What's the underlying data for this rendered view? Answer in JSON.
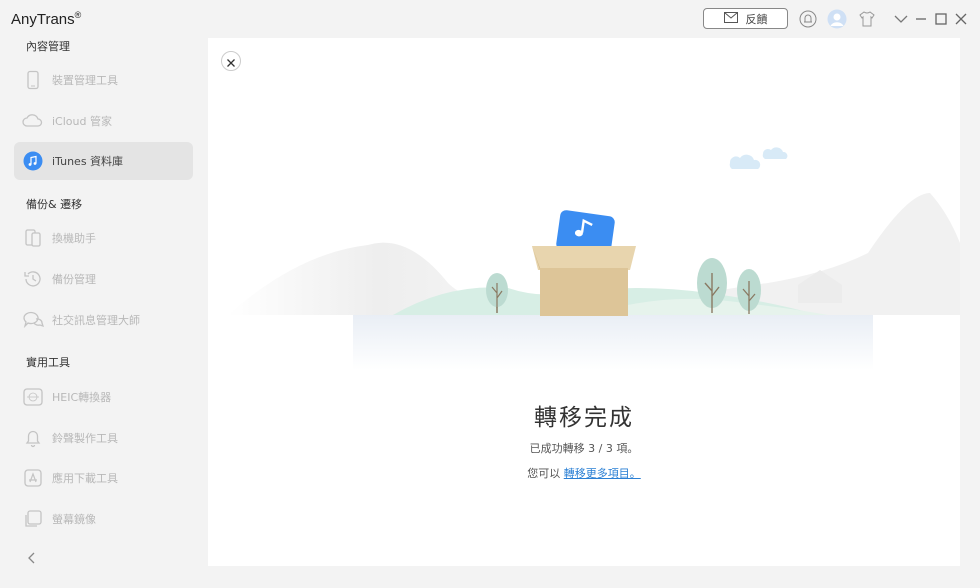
{
  "app": {
    "title": "AnyTrans",
    "reg": "®"
  },
  "toolbar": {
    "feedback_label": "反饋"
  },
  "sidebar": {
    "sections": [
      {
        "title": "內容管理"
      },
      {
        "title": "備份& 遷移"
      },
      {
        "title": "實用工具"
      }
    ],
    "items": [
      {
        "label": "裝置管理工具",
        "icon": "phone-icon"
      },
      {
        "label": "iCloud 管家",
        "icon": "cloud-icon"
      },
      {
        "label": "iTunes 資料庫",
        "icon": "music-note-icon",
        "active": true
      },
      {
        "label": "換機助手",
        "icon": "phone-transfer-icon"
      },
      {
        "label": "備份管理",
        "icon": "history-clock-icon"
      },
      {
        "label": "社交訊息管理大師",
        "icon": "chat-bubble-icon"
      },
      {
        "label": "HEIC轉換器",
        "icon": "heic-convert-icon"
      },
      {
        "label": "鈴聲製作工具",
        "icon": "bell-icon"
      },
      {
        "label": "應用下載工具",
        "icon": "app-store-icon"
      },
      {
        "label": "螢幕鏡像",
        "icon": "screen-mirror-icon"
      }
    ]
  },
  "main": {
    "done_title": "轉移完成",
    "done_sub": "已成功轉移 3 / 3 項。",
    "more_prefix": "您可以",
    "more_link": "轉移更多項目。"
  },
  "colors": {
    "accent": "#2a7fd4",
    "icon_blue": "#3b8df2",
    "selected_bg": "#e4e4e4",
    "panel": "#ffffff",
    "window": "#f3f3f3"
  }
}
